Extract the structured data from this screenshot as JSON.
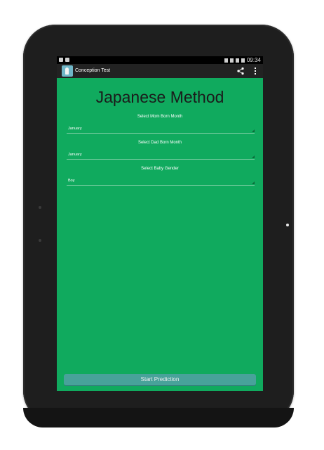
{
  "status_bar": {
    "time": "09:34"
  },
  "action_bar": {
    "title": "Conception Test"
  },
  "main": {
    "heading": "Japanese Method",
    "mom_month": {
      "label": "Select Mom Born Month",
      "value": "January"
    },
    "dad_month": {
      "label": "Select Dad Born Month",
      "value": "January"
    },
    "baby_gender": {
      "label": "Select Baby Gender",
      "value": "Boy"
    },
    "start_button": "Start Prediction"
  },
  "colors": {
    "screen_background": "#10aa5e",
    "button": "#48a29a",
    "action_bar": "#222222"
  }
}
